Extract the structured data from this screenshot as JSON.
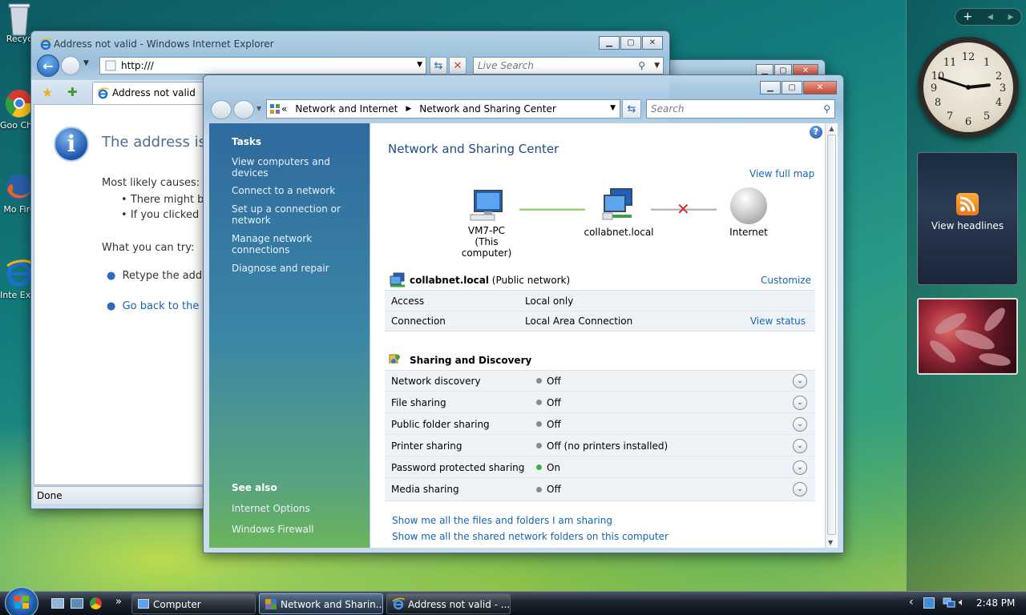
{
  "desktop": {
    "icons": [
      {
        "label": "Recyc",
        "icon": "recycle-bin-icon"
      },
      {
        "label": "Goo Chro",
        "icon": "chrome-icon"
      },
      {
        "label": "Mo Fire",
        "icon": "firefox-icon"
      },
      {
        "label": "Inte Explor",
        "icon": "internet-explorer-icon"
      }
    ]
  },
  "sidebar": {
    "controls": {
      "add": "+",
      "prev": "◂",
      "next": "▸"
    },
    "clock": {
      "hour": 14,
      "minute": 48
    },
    "news": {
      "label": "View headlines"
    }
  },
  "ie": {
    "title": "Address not valid - Windows Internet Explorer",
    "address": "http:///",
    "search_placeholder": "Live Search",
    "tab_label": "Address not valid",
    "heading": "The address is n",
    "causes_label": "Most likely causes:",
    "causes": [
      "There might b",
      "If you clicked o"
    ],
    "try_label": "What you can try:",
    "tries": [
      "Retype the addr",
      "Go back to the p"
    ],
    "status": "Done"
  },
  "network": {
    "breadcrumb": {
      "root": "«",
      "parent": "Network and Internet",
      "current": "Network and Sharing Center"
    },
    "search_placeholder": "Search",
    "tasks": {
      "heading": "Tasks",
      "items": [
        "View computers and devices",
        "Connect to a network",
        "Set up a connection or network",
        "Manage network connections",
        "Diagnose and repair"
      ]
    },
    "see_also": {
      "heading": "See also",
      "items": [
        "Internet Options",
        "Windows Firewall"
      ]
    },
    "title": "Network and Sharing Center",
    "view_full_map": "View full map",
    "map": {
      "computer": "VM7-PC",
      "computer_sub": "(This computer)",
      "network": "collabnet.local",
      "internet": "Internet"
    },
    "connection": {
      "name": "collabnet.local",
      "type": "(Public network)",
      "customize": "Customize",
      "rows": [
        {
          "label": "Access",
          "value": "Local only",
          "action": ""
        },
        {
          "label": "Connection",
          "value": "Local Area Connection",
          "action": "View status"
        }
      ]
    },
    "sharing": {
      "heading": "Sharing and Discovery",
      "rows": [
        {
          "label": "Network discovery",
          "value": "Off",
          "on": false
        },
        {
          "label": "File sharing",
          "value": "Off",
          "on": false
        },
        {
          "label": "Public folder sharing",
          "value": "Off",
          "on": false
        },
        {
          "label": "Printer sharing",
          "value": "Off (no printers installed)",
          "on": false
        },
        {
          "label": "Password protected sharing",
          "value": "On",
          "on": true
        },
        {
          "label": "Media sharing",
          "value": "Off",
          "on": false
        }
      ]
    },
    "footer_links": [
      "Show me all the files and folders I am sharing",
      "Show me all the shared network folders on this computer"
    ]
  },
  "taskbar": {
    "buttons": [
      "Computer",
      "Network and Sharin...",
      "Address not valid - ..."
    ],
    "overflow": "»",
    "tray_arrow": "‹",
    "time": "2:48 PM"
  }
}
